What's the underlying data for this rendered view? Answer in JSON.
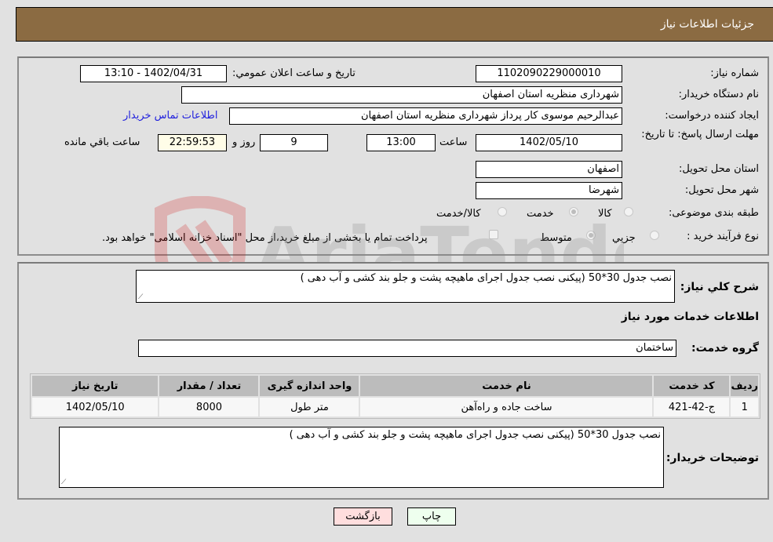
{
  "header": {
    "title": "جزئیات اطلاعات نیاز"
  },
  "fields": {
    "need_number": {
      "label": "شماره نیاز:",
      "value": "1102090229000010"
    },
    "announce_datetime": {
      "label": "تاریخ و ساعت اعلان عمومي:",
      "value": "1402/04/31 - 13:10"
    },
    "buyer_org": {
      "label": "نام دستگاه خریدار:",
      "value": "شهرداری منظریه استان اصفهان"
    },
    "requester": {
      "label": "ایجاد کننده درخواست:",
      "value": "عبدالرحیم موسوی کار پرداز  شهرداری منظریه استان اصفهان"
    },
    "buyer_contact_link": "اطلاعات تماس خریدار",
    "deadline": {
      "label": "مهلت ارسال پاسخ: تا تاریخ:",
      "date": "1402/05/10",
      "time_label": "ساعت",
      "time": "13:00",
      "days": "9",
      "days_label": "روز و",
      "remaining": "22:59:53",
      "remaining_label": "ساعت باقي مانده"
    },
    "province": {
      "label": "استان محل تحویل:",
      "value": "اصفهان"
    },
    "city": {
      "label": "شهر محل تحویل:",
      "value": "شهرضا"
    },
    "category": {
      "label": "طبقه بندی موضوعی:",
      "options": [
        "کالا",
        "خدمت",
        "کالا/خدمت"
      ],
      "selected": "خدمت"
    },
    "purchase_type": {
      "label": "نوع فرآیند خرید :",
      "options": [
        "جزيي",
        "متوسط"
      ],
      "selected": "متوسط",
      "treasury_note": "پرداخت تمام یا بخشی از مبلغ خرید،از محل \"اسناد خزانه اسلامی\" خواهد بود."
    }
  },
  "details": {
    "summary_label": "شرح كلي نياز:",
    "summary_value": "نصب جدول 30*50 (پیکنی نصب جدول اجرای ماهیچه پشت و جلو بند کشی و آب دهی )",
    "services_heading": "اطلاعات خدمات مورد نیاز",
    "service_group_label": "گروه خدمت:",
    "service_group_value": "ساختمان",
    "table": {
      "headers": [
        "ردیف",
        "کد خدمت",
        "نام خدمت",
        "واحد اندازه گیری",
        "تعداد / مقدار",
        "تاریخ نیاز"
      ],
      "rows": [
        [
          "1",
          "ج-42-421",
          "ساخت جاده و راه‌آهن",
          "متر طول",
          "8000",
          "1402/05/10"
        ]
      ]
    },
    "buyer_notes_label": "توضیحات خریدار:",
    "buyer_notes_value": "نصب جدول 30*50 (پیکنی نصب جدول اجرای ماهیچه پشت و جلو بند کشی و آب دهی )"
  },
  "buttons": {
    "print": "چاپ",
    "back": "بازگشت"
  },
  "watermark": {
    "text": "AriaTender.neT"
  }
}
